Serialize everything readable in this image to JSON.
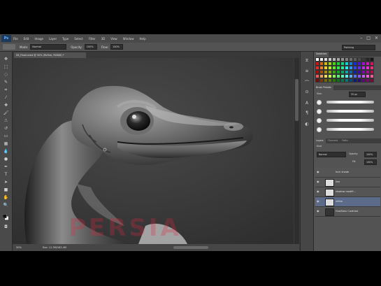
{
  "app": {
    "logo": "Ps"
  },
  "menu": [
    "File",
    "Edit",
    "Image",
    "Layer",
    "Type",
    "Select",
    "Filter",
    "3D",
    "View",
    "Window",
    "Help"
  ],
  "options": {
    "mode_label": "Mode:",
    "mode_value": "Normal",
    "opacity_label": "Opacity:",
    "opacity_value": "100%",
    "flow_label": "Flow:",
    "flow_value": "100%",
    "workspace": "Painting"
  },
  "document": {
    "tab_title": "06_Finalcuted @ 50% (Refine, RGB/8) *",
    "zoom": "50%",
    "doc_info": "Doc: 11.3M/163.4M"
  },
  "panels": {
    "swatches_tabs": [
      "Swatches"
    ],
    "brush_presets_tab": "Brush Presets",
    "brush_size_label": "Size:",
    "brush_size_value": "35 px",
    "layers_tabs": [
      "Layers",
      "Channels",
      "Paths"
    ],
    "blend_mode": "Normal",
    "opacity_label": "Opacity:",
    "opacity_value": "100%",
    "fill_label": "Fill:",
    "fill_value": "100%",
    "kind_label": "Kind",
    "layers": [
      {
        "name": "Inch shade",
        "selected": false
      },
      {
        "name": "line",
        "selected": false
      },
      {
        "name": "shadow modifi...",
        "selected": false
      },
      {
        "name": "refine",
        "selected": true
      },
      {
        "name": "Hue/Satu Contrast",
        "selected": false
      }
    ]
  },
  "watermark": "PERSIA",
  "colors": {
    "ui_dark": "#3c3c3c",
    "accent_selected": "#5c6b8a",
    "watermark": "#dc283c"
  }
}
